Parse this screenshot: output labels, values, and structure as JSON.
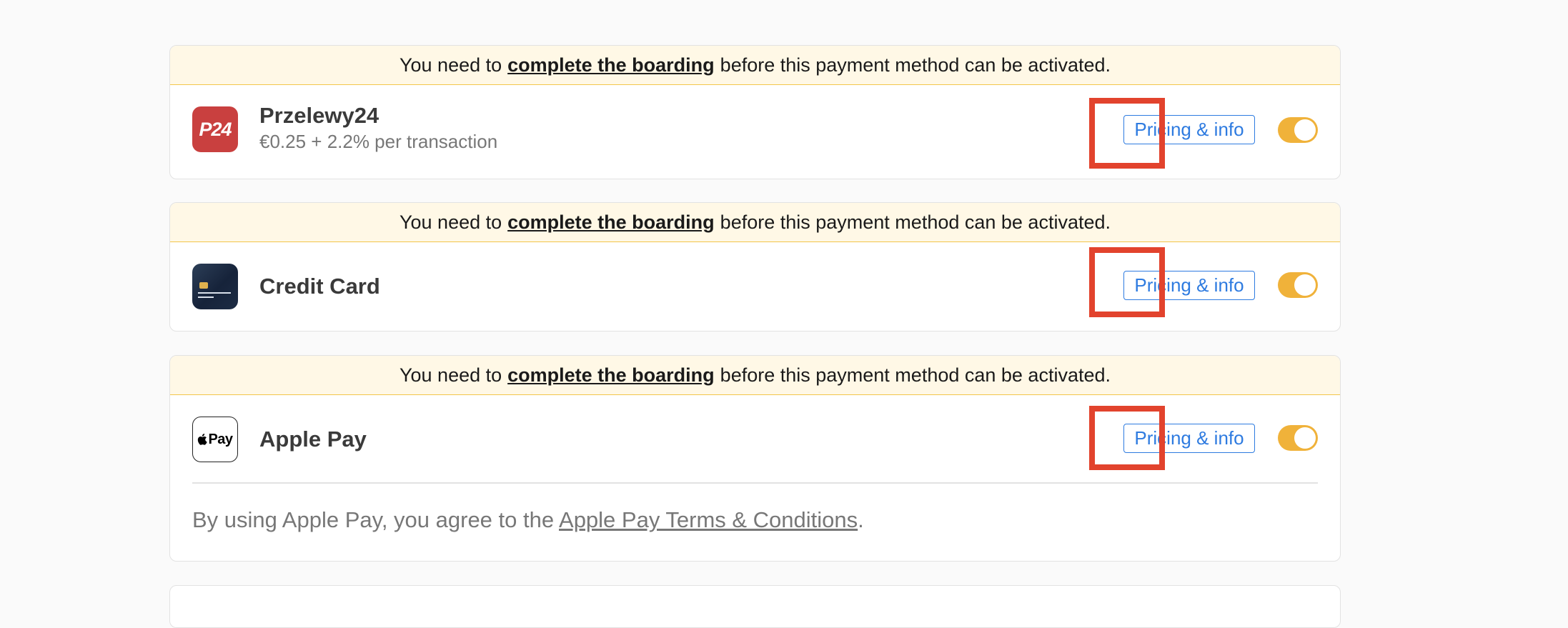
{
  "notice": {
    "prefix": "You need to",
    "link": "complete the boarding",
    "suffix": "before this payment method can be activated."
  },
  "methods": [
    {
      "name": "Przelewy24",
      "subtitle": "€0.25 + 2.2% per transaction",
      "logo_text": "P24",
      "pricing_label": "Pricing & info",
      "enabled": true
    },
    {
      "name": "Credit Card",
      "logo_text": "",
      "pricing_label": "Pricing & info",
      "enabled": true
    },
    {
      "name": "Apple Pay",
      "logo_text": "Pay",
      "pricing_label": "Pricing & info",
      "enabled": true,
      "terms": {
        "prefix": "By using Apple Pay, you agree to the",
        "link": "Apple Pay Terms & Conditions",
        "suffix": "."
      }
    }
  ],
  "colors": {
    "toggle_on": "#f0b23a",
    "link_blue": "#2e7be0",
    "highlight_red": "#e2432d",
    "notice_bg": "#fff8e6",
    "p24_red": "#c9403f"
  }
}
